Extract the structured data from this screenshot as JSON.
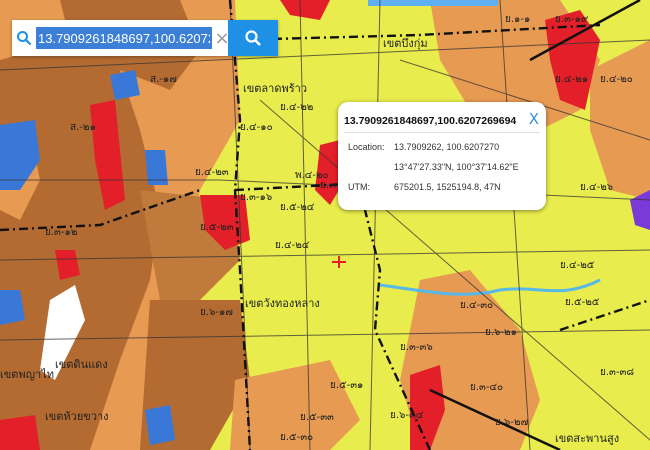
{
  "search": {
    "value": "13.7909261848697,100.6207269694"
  },
  "popup": {
    "title": "13.7909261848697,100.6207269694",
    "close_label": "X",
    "location_label": "Location:",
    "location_decimal": "13.7909262, 100.6207270",
    "location_dms": "13°47'27.33\"N, 100°37'14.62\"E",
    "utm_label": "UTM:",
    "utm_value": "675201.5, 1525194.8, 47N"
  },
  "map": {
    "district_labels": [
      "เขตบึงกุ่ม",
      "เขตลาดพร้าว",
      "เขตวังทองหลาง",
      "เขตดินแดง",
      "เขตพญาไท",
      "เขตห้วยขวาง",
      "เขตสะพานสูง"
    ],
    "zone_labels": [
      "ย.๑-๑",
      "ย.๓-๑๙",
      "ย.๔-๒๐",
      "ย.๔-๒๑",
      "ส.-๑๗",
      "ส.-๒๑",
      "ย.๔-๒๒",
      "ย.๔-๑๐",
      "ย.๔-๒๓",
      "ย.๓-๑๖",
      "ย.๔-๒๔",
      "ย.๓-๑๘",
      "ย.๕-๒๔",
      "ย.๕-๒๓",
      "ย.๔-๒๖",
      "ย.๔-๒๕",
      "ย.๕-๒๕",
      "ย.๖-๒๑",
      "ย.๔-๓๐",
      "ย.๓-๓๘",
      "ย.๓-๔๐",
      "ย.๖-๒๗",
      "ย.๕-๓๑",
      "ย.๕-๓๓",
      "ย.๖-๓๔",
      "ย.๓-๓๖",
      "ย.๕-๓๐",
      "ย.๓-๑๒",
      "พ.๔-๒๐",
      "ย.๖-๑๗"
    ],
    "colors": {
      "yellow_zone": "#e8ec4c",
      "orange_zone": "#e79a52",
      "brown_zone": "#b36b32",
      "red_zone": "#e3202a",
      "blue_zone": "#3a78d8",
      "water": "#58b8e8"
    }
  }
}
